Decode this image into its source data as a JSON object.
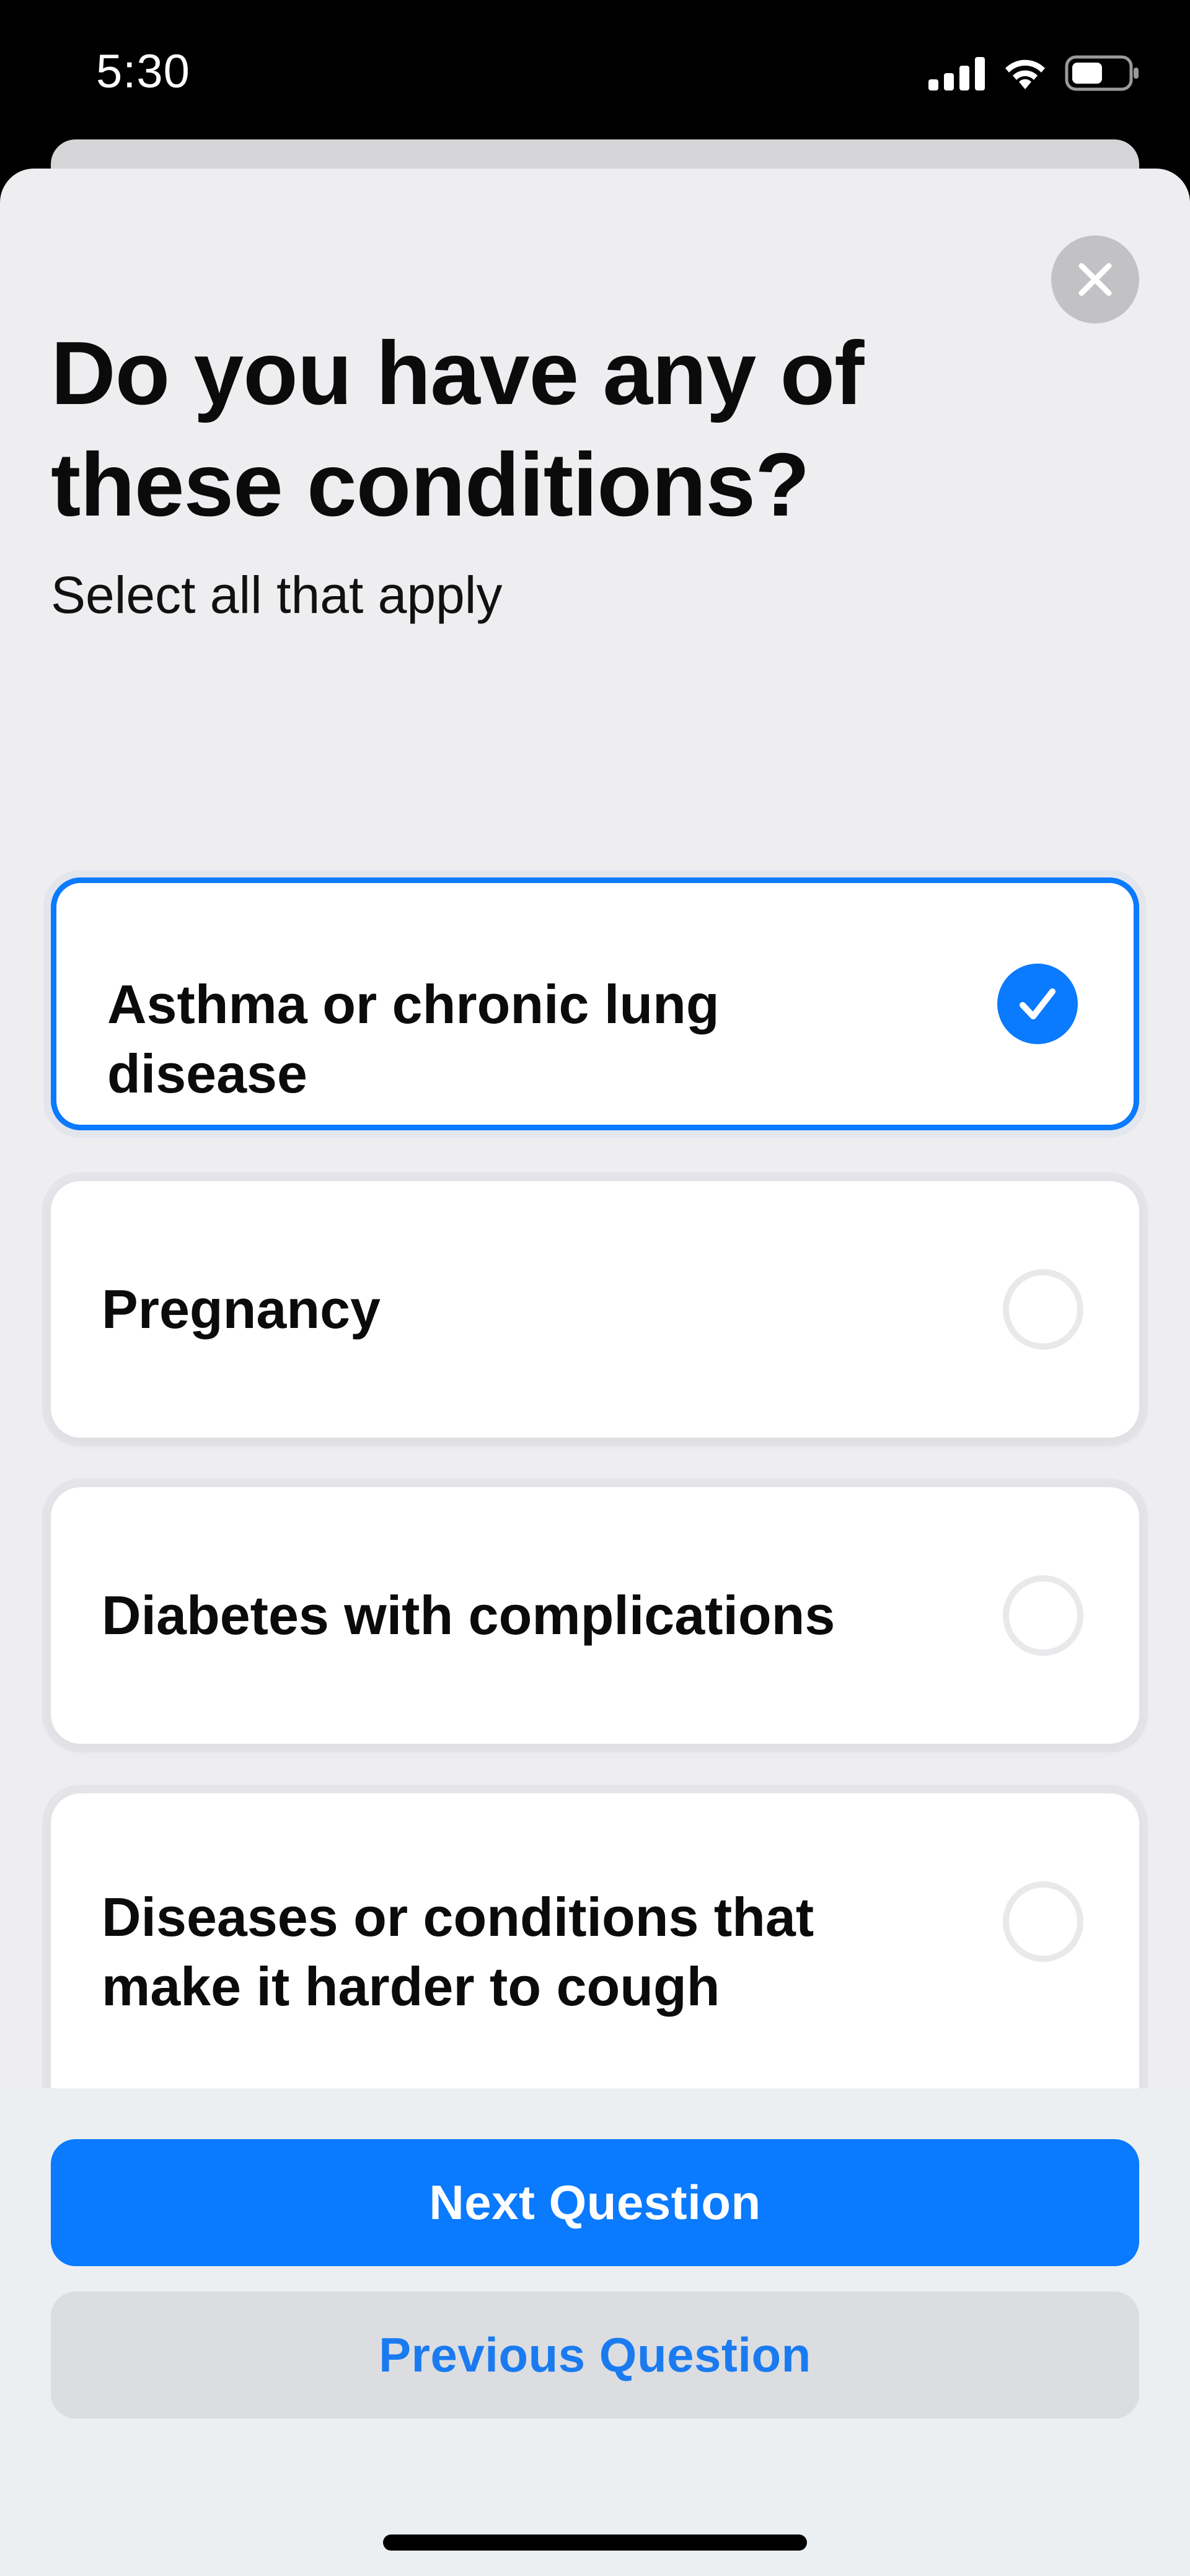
{
  "status_bar": {
    "time": "5:30",
    "icons": [
      "cellular-signal-icon",
      "wifi-icon",
      "battery-icon"
    ]
  },
  "sheet": {
    "close_icon": "close-icon",
    "title": "Do you have any of these conditions?",
    "subtitle": "Select all that apply",
    "options": [
      {
        "label": "Asthma or chronic lung disease",
        "selected": true
      },
      {
        "label": "Pregnancy",
        "selected": false
      },
      {
        "label": "Diabetes with complications",
        "selected": false
      },
      {
        "label": "Diseases or conditions that make it harder to cough",
        "selected": false
      }
    ]
  },
  "footer": {
    "next_label": "Next Question",
    "previous_label": "Previous Question"
  },
  "colors": {
    "accent": "#0a7aff",
    "sheet_background": "#eeeef1",
    "secondary_button": "#dcdde1"
  }
}
